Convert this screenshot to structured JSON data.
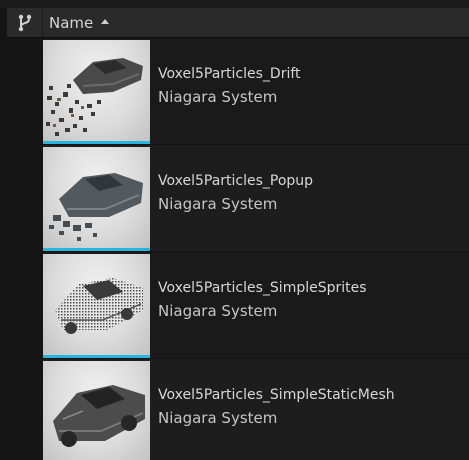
{
  "header": {
    "name_label": "Name",
    "sort_direction": "ascending",
    "column_icon": "branch-icon"
  },
  "colors": {
    "accent_thumb_bar": "#27b5df",
    "header_bg": "#2a2a2a",
    "row_bg": "#1a1a1a"
  },
  "assets": [
    {
      "name": "Voxel5Particles_Drift",
      "type": "Niagara System",
      "thumbnail": "car-drift-thumbnail"
    },
    {
      "name": "Voxel5Particles_Popup",
      "type": "Niagara System",
      "thumbnail": "car-popup-thumbnail"
    },
    {
      "name": "Voxel5Particles_SimpleSprites",
      "type": "Niagara System",
      "thumbnail": "car-sprites-thumbnail"
    },
    {
      "name": "Voxel5Particles_SimpleStaticMesh",
      "type": "Niagara System",
      "thumbnail": "car-staticmesh-thumbnail"
    }
  ]
}
